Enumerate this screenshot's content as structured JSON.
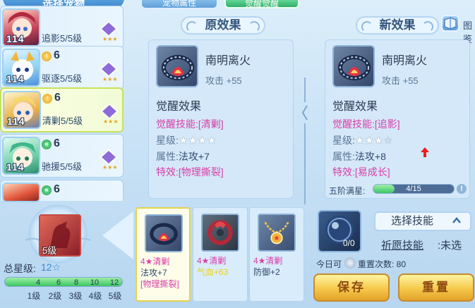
{
  "pet_list": {
    "header": "选择宠物",
    "items": [
      {
        "level": "114",
        "count": "",
        "skill": "追影5/5级",
        "badge": "",
        "selected": false
      },
      {
        "level": "114",
        "count": "6",
        "skill": "驱逐5/5级",
        "badge": "gold",
        "selected": false
      },
      {
        "level": "114",
        "count": "6",
        "skill": "清剿5/5级",
        "badge": "gold",
        "selected": true
      },
      {
        "level": "114",
        "count": "6",
        "skill": "驰援5/5级",
        "badge": "green",
        "selected": false
      },
      {
        "level": "",
        "count": "6",
        "skill": "",
        "badge": "green",
        "selected": false
      }
    ]
  },
  "tabs": [
    {
      "label": "宠物属性",
      "active": false
    },
    {
      "label": "觉醒觉醒",
      "active": true
    }
  ],
  "old_effect": {
    "title": "原效果",
    "item_name": "南明离火",
    "item_stat": "攻击 +55",
    "awaken_title": "觉醒效果",
    "skill_label": "觉醒技能:",
    "skill_value": "[清剿]",
    "star_label": "星级:",
    "stars": "★★★★",
    "attr_label": "属性:",
    "attr_value": "法攻+7",
    "special_label": "特效:",
    "special_value": "[物理撕裂]"
  },
  "new_effect": {
    "title": "新效果",
    "item_name": "南明离火",
    "item_stat": "攻击 +55",
    "awaken_title": "觉醒效果",
    "skill_label": "觉醒技能:",
    "skill_value": "[追影]",
    "star_label": "星级:",
    "stars": "★★★☆",
    "attr_label": "属性:",
    "attr_value": "法攻+8",
    "special_label": "特效:",
    "special_value": "[易成长]"
  },
  "map_label": "图鉴",
  "progress": {
    "label": "五阶满星:",
    "text": "4/15",
    "fraction": 0.267
  },
  "gear_slot": {
    "label": "5级"
  },
  "total_star": {
    "label": "总星级:",
    "value": "12☆"
  },
  "level_bar": {
    "ticks": [
      "4",
      "6",
      "8",
      "10",
      "12"
    ],
    "names": [
      "1级",
      "2级",
      "3级",
      "4级",
      "5级"
    ]
  },
  "candidates": [
    {
      "title": "4★清剿",
      "line2": "法攻+7",
      "line3": "[物理撕裂]",
      "selected": true,
      "line2_color": "#2f4a6c"
    },
    {
      "title": "4★清剿",
      "line2": "气血+63",
      "line3": "",
      "selected": false,
      "line2_color": "#e9d21b"
    },
    {
      "title": "4★清剿",
      "line2": "防御+2",
      "line3": "",
      "selected": false,
      "line2_color": "#2f4a6c"
    }
  ],
  "orb": {
    "count": "0/0"
  },
  "select_skill": {
    "label": "选择技能"
  },
  "wish": {
    "label": "祈愿技能",
    "value": ":未选"
  },
  "today": {
    "left": "今日可",
    "right": "重置次数: 80"
  },
  "buttons": {
    "save": "保存",
    "reset": "重置"
  },
  "colors": {
    "pink": "#d93fa8",
    "red_arrow": "#e8201d",
    "gold": "#f5c84a",
    "green": "#3dc566"
  }
}
